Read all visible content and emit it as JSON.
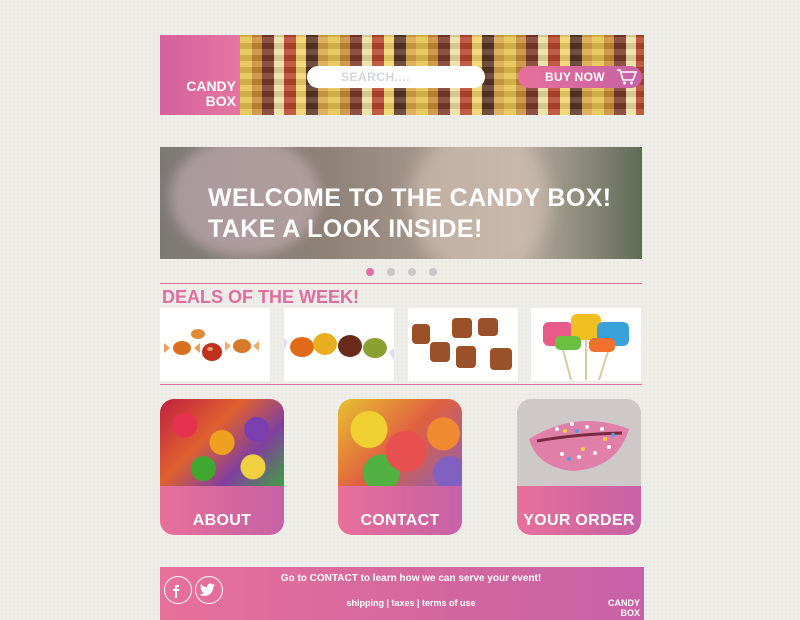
{
  "header": {
    "logo_line1": "CANDY",
    "logo_line2": "BOX",
    "search_placeholder": "SEARCH....",
    "buy_label": "BUY NOW",
    "cart_icon": "shopping-cart-icon"
  },
  "hero": {
    "line1": "WELCOME TO THE CANDY BOX!",
    "line2": "TAKE A LOOK INSIDE!",
    "slide_count": 4,
    "active_slide": 1
  },
  "deals": {
    "title": "DEALS OF THE WEEK!",
    "items": [
      "toffee-candies",
      "hard-candies",
      "chocolate-bonbons",
      "lollipops"
    ]
  },
  "cards": [
    {
      "label": "ABOUT",
      "image": "gummy-bears"
    },
    {
      "label": "CONTACT",
      "image": "jelly-candies"
    },
    {
      "label": "YOUR ORDER",
      "image": "sprinkle-lips"
    }
  ],
  "footer": {
    "message": "Go to CONTACT to learn how we can serve your event!",
    "links": "shipping | taxes | terms of use",
    "logo_line1": "CANDY",
    "logo_line2": "BOX",
    "social": [
      "facebook-icon",
      "twitter-icon"
    ]
  },
  "colors": {
    "brand_pink": "#e070a2",
    "background": "#eeede8"
  }
}
